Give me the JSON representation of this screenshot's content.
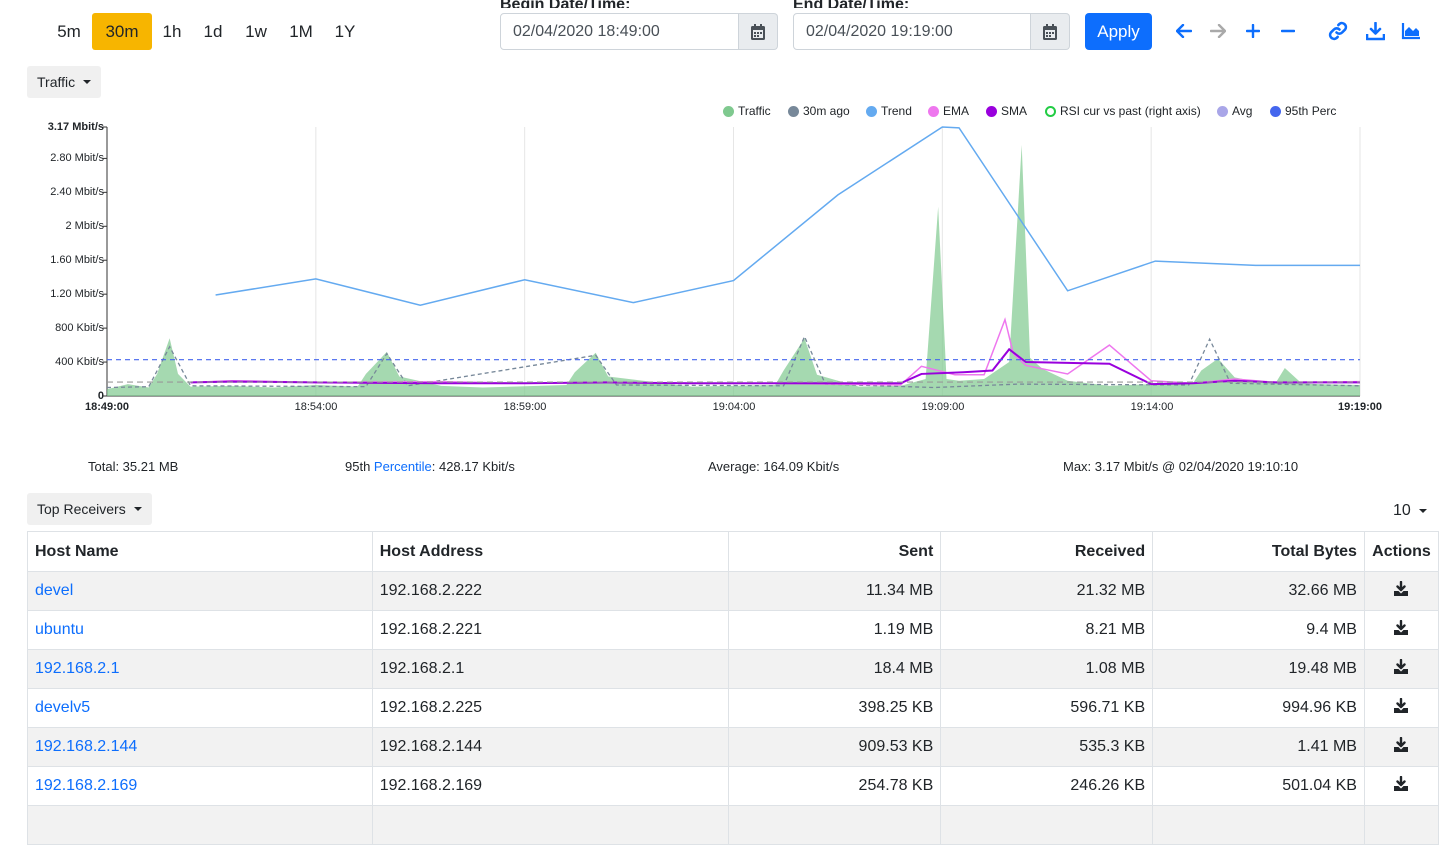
{
  "time_ranges": [
    "5m",
    "30m",
    "1h",
    "1d",
    "1w",
    "1M",
    "1Y"
  ],
  "active_range": "30m",
  "begin": {
    "label": "Begin Date/Time:",
    "value": "02/04/2020 18:49:00"
  },
  "end": {
    "label": "End Date/Time:",
    "value": "02/04/2020 19:19:00"
  },
  "apply_label": "Apply",
  "accent_color": "#0d6efd",
  "highlight_color": "#f7b500",
  "toolbar_icons": [
    "arrow-left-icon",
    "arrow-right-icon",
    "zoom-in-icon",
    "zoom-out-icon",
    "link-icon",
    "download-icon",
    "chart-area-icon"
  ],
  "metric_dropdown": "Traffic",
  "legend": [
    {
      "label": "Traffic",
      "color": "#7fc98f"
    },
    {
      "label": "30m ago",
      "color": "#778899"
    },
    {
      "label": "Trend",
      "color": "#64aaf0"
    },
    {
      "label": "EMA",
      "color": "#ee77ee"
    },
    {
      "label": "SMA",
      "color": "#9900dd"
    },
    {
      "label": "RSI cur vs past (right axis)",
      "color": "#22cc44"
    },
    {
      "label": "Avg",
      "color": "#a9a6e8"
    },
    {
      "label": "95th Perc",
      "color": "#4466ee"
    }
  ],
  "chart_data": {
    "type": "area",
    "y_tick_labels": [
      "0",
      "400 Kbit/s",
      "800 Kbit/s",
      "1.20 Mbit/s",
      "1.60 Mbit/s",
      "2 Mbit/s",
      "2.40 Mbit/s",
      "2.80 Mbit/s",
      "3.17 Mbit/s"
    ],
    "y_ticks_kbps": [
      0,
      400,
      800,
      1200,
      1600,
      2000,
      2400,
      2800,
      3170
    ],
    "ylim_kbps": [
      0,
      3170
    ],
    "x_tick_labels": [
      "18:49:00",
      "18:54:00",
      "18:59:00",
      "19:04:00",
      "19:09:00",
      "19:14:00",
      "19:19:00"
    ],
    "x_ticks_min": [
      0,
      5,
      10,
      15,
      20,
      25,
      30
    ],
    "xlim_min": [
      0,
      30
    ],
    "grid": true,
    "legend_position": "top-right",
    "series": [
      {
        "name": "Traffic",
        "x": [
          0,
          0.5,
          1,
          1.2,
          1.5,
          1.7,
          2,
          3,
          4,
          5,
          6,
          6.2,
          6.7,
          7,
          8,
          9,
          11,
          11.2,
          11.7,
          12,
          14,
          16,
          16.2,
          16.7,
          17,
          18,
          19,
          19.6,
          19.9,
          20.1,
          20.4,
          21,
          21.6,
          21.9,
          22.1,
          22.4,
          23,
          24,
          25,
          26,
          26.2,
          26.6,
          27,
          27.6,
          28,
          28.2,
          28.6,
          29,
          30
        ],
        "y": [
          80,
          140,
          100,
          260,
          680,
          260,
          110,
          120,
          100,
          130,
          110,
          260,
          520,
          230,
          120,
          100,
          130,
          280,
          510,
          230,
          110,
          130,
          300,
          680,
          250,
          110,
          120,
          200,
          2230,
          200,
          180,
          200,
          400,
          2960,
          450,
          320,
          180,
          120,
          140,
          150,
          300,
          440,
          220,
          160,
          170,
          330,
          150,
          140,
          130
        ]
      },
      {
        "name": "30m ago",
        "x": [
          0,
          1,
          1.5,
          2,
          6.2,
          6.7,
          7.2,
          11.7,
          12.2,
          16.2,
          16.7,
          17.2,
          19.8,
          21.8,
          25.9,
          26.4,
          26.9,
          30
        ],
        "y": [
          100,
          110,
          580,
          120,
          110,
          500,
          120,
          480,
          130,
          120,
          700,
          140,
          100,
          140,
          130,
          670,
          150,
          120
        ]
      },
      {
        "name": "Trend",
        "x": [
          2.6,
          5,
          7.5,
          10,
          12.6,
          15,
          17.5,
          20,
          20.4,
          23,
          25.1,
          27.5,
          30
        ],
        "y": [
          1190,
          1380,
          1070,
          1370,
          1100,
          1360,
          2370,
          3170,
          3160,
          1240,
          1590,
          1540,
          1540
        ]
      },
      {
        "name": "EMA",
        "x": [
          2,
          3,
          5,
          8,
          10,
          12,
          14,
          16,
          19,
          19.5,
          20.3,
          21,
          21.5,
          21.7,
          22,
          23,
          24,
          25,
          26,
          27,
          28,
          30
        ],
        "y": [
          160,
          180,
          160,
          170,
          150,
          160,
          150,
          150,
          130,
          350,
          250,
          250,
          900,
          500,
          360,
          260,
          600,
          180,
          150,
          200,
          160,
          170
        ]
      },
      {
        "name": "SMA",
        "x": [
          2,
          3,
          5,
          8,
          10,
          12,
          14,
          16,
          19,
          19.5,
          20.5,
          21.2,
          21.6,
          22,
          23,
          24,
          25,
          26,
          27,
          28,
          30
        ],
        "y": [
          160,
          170,
          160,
          150,
          150,
          160,
          150,
          150,
          150,
          260,
          280,
          300,
          550,
          400,
          390,
          380,
          140,
          150,
          180,
          160,
          160
        ]
      },
      {
        "name": "Avg",
        "values": [
          164.09
        ]
      },
      {
        "name": "95th Perc",
        "values": [
          428.17
        ]
      }
    ]
  },
  "stats": {
    "total": "Total: 35.21 MB",
    "percentile_prefix": "95th ",
    "percentile_link": "Percentile",
    "percentile_value": ": 428.17 Kbit/s",
    "average": "Average: 164.09 Kbit/s",
    "max": "Max: 3.17 Mbit/s @ 02/04/2020 19:10:10"
  },
  "top_dropdown": "Top Receivers",
  "page_size": "10",
  "table": {
    "headers": [
      "Host Name",
      "Host Address",
      "Sent",
      "Received",
      "Total Bytes",
      "Actions"
    ],
    "rows": [
      {
        "name": "devel",
        "address": "192.168.2.222",
        "sent": "11.34 MB",
        "received": "21.32 MB",
        "total": "32.66 MB"
      },
      {
        "name": "ubuntu",
        "address": "192.168.2.221",
        "sent": "1.19 MB",
        "received": "8.21 MB",
        "total": "9.4 MB"
      },
      {
        "name": "192.168.2.1",
        "address": "192.168.2.1",
        "sent": "18.4 MB",
        "received": "1.08 MB",
        "total": "19.48 MB"
      },
      {
        "name": "develv5",
        "address": "192.168.2.225",
        "sent": "398.25 KB",
        "received": "596.71 KB",
        "total": "994.96 KB"
      },
      {
        "name": "192.168.2.144",
        "address": "192.168.2.144",
        "sent": "909.53 KB",
        "received": "535.3 KB",
        "total": "1.41 MB"
      },
      {
        "name": "192.168.2.169",
        "address": "192.168.2.169",
        "sent": "254.78 KB",
        "received": "246.26 KB",
        "total": "501.04 KB"
      }
    ]
  }
}
